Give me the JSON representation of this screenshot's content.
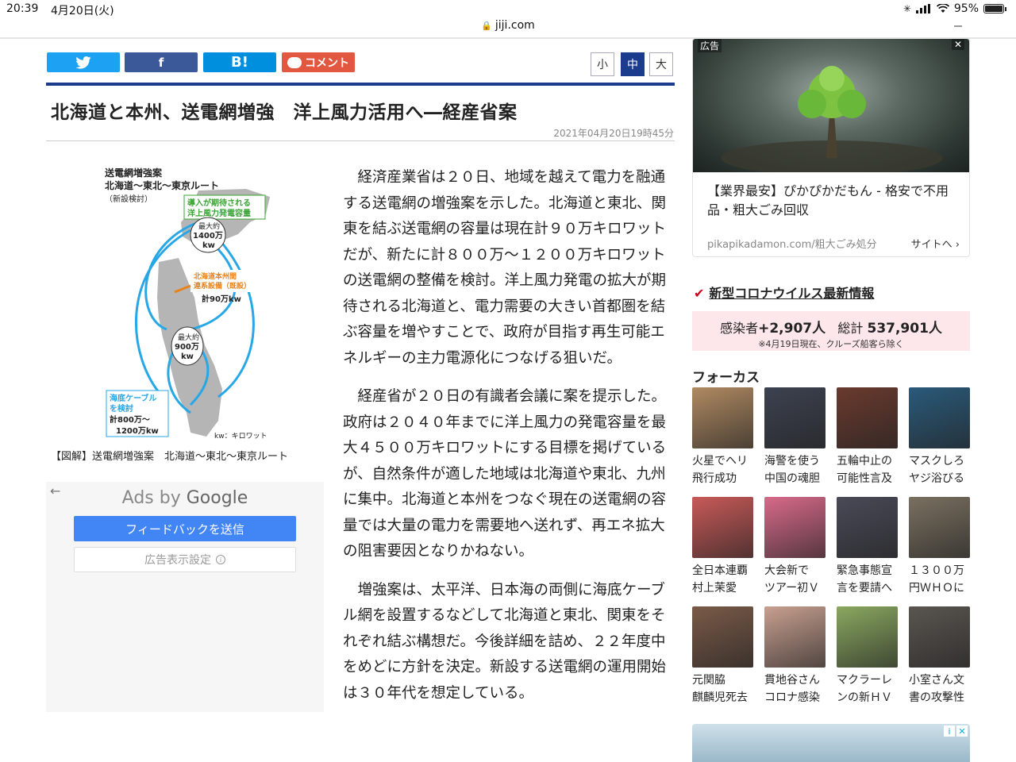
{
  "status": {
    "time": "20:39",
    "date": "4月20日(火)",
    "battery": "95%"
  },
  "browser": {
    "url": "jiji.com"
  },
  "share": {
    "twitter": "twitter",
    "facebook": "f",
    "hatena": "B!",
    "comment": "コメント"
  },
  "font_size": {
    "small": "小",
    "medium": "中",
    "large": "大"
  },
  "article": {
    "title": "北海道と本州、送電網増強　洋上風力活用へ―経産省案",
    "date": "2021年04月20日19時45分",
    "figure": {
      "heading": [
        "送電網増強案",
        "北海道～東北～東京ルート"
      ],
      "sub": "（新設検討）",
      "label_green": [
        "導入が期待される",
        "洋上風力発電容量"
      ],
      "max1": [
        "最大約",
        "1400万",
        "kw"
      ],
      "orange": [
        "北海道本州間",
        "連系設備（既設）"
      ],
      "orange_total": "計90万kw",
      "max2": [
        "最大約",
        "900万",
        "kw"
      ],
      "cable": [
        "海底ケーブル",
        "を検討",
        "計800万～",
        "1200万kw"
      ],
      "unit": "kw：キロワット"
    },
    "caption": "【図解】送電網増強案　北海道～東北～東京ルート",
    "paragraphs": [
      "経済産業省は２０日、地域を越えて電力を融通する送電網の増強案を示した。北海道と東北、関東を結ぶ送電網の容量は現在計９０万キロワットだが、新たに計８００万～１２００万キロワットの送電網の整備を検討。洋上風力発電の拡大が期待される北海道と、電力需要の大きい首都圏を結ぶ容量を増やすことで、政府が目指す再生可能エネルギーの主力電源化につなげる狙いだ。",
      "経産省が２０日の有識者会議に案を提示した。政府は２０４０年までに洋上風力の発電容量を最大４５００万キロワットにする目標を掲げているが、自然条件が適した地域は北海道や東北、九州に集中。北海道と本州をつなぐ現在の送電網の容量では大量の電力を需要地へ送れず、再エネ拡大の阻害要因となりかねない。",
      "増強案は、太平洋、日本海の両側に海底ケーブル網を設置するなどして北海道と東北、関東をそれぞれ結ぶ構想だ。今後詳細を詰め、２２年度中をめどに方針を決定。新設する送電網の運用開始は３０年代を想定している。"
    ]
  },
  "google_ad": {
    "back": "←",
    "ads_by": "Ads by",
    "google": "Google",
    "feedback": "フィードバックを送信",
    "settings": "広告表示設定"
  },
  "side_ad": {
    "label": "広告",
    "text": "【業界最安】ぴかぴかだもん - 格安で不用品・粗大ごみ回収",
    "domain": "pikapikadamon.com/粗大ごみ処分",
    "site": "サイトへ"
  },
  "corona": {
    "heading": "新型コロナウイルス最新情報",
    "infected_label": "感染者",
    "infected": "+2,907人",
    "total_label": "総計",
    "total": "537,901人",
    "note": "※4月19日現在、クルーズ船客ら除く"
  },
  "focus": {
    "heading": "フォーカス",
    "items": [
      {
        "l1": "火星でヘリ",
        "l2": "飛行成功",
        "color": "#b08a62"
      },
      {
        "l1": "海警を使う",
        "l2": "中国の魂胆",
        "color": "#3d4250"
      },
      {
        "l1": "五輪中止の",
        "l2": "可能性言及",
        "color": "#6a3a2e"
      },
      {
        "l1": "マスクしろ",
        "l2": "ヤジ浴びる",
        "color": "#2a5a7a"
      },
      {
        "l1": "全日本連覇",
        "l2": "村上茉愛",
        "color": "#c85a58"
      },
      {
        "l1": "大会新で",
        "l2": "ツアー初Ｖ",
        "color": "#d86a8a"
      },
      {
        "l1": "緊急事態宣",
        "l2": "言を要請へ",
        "color": "#4a4a58"
      },
      {
        "l1": "１３００万",
        "l2": "円ＷＨＯに",
        "color": "#7a7060"
      },
      {
        "l1": "元関脇",
        "l2": "麒麟児死去",
        "color": "#7a5a48"
      },
      {
        "l1": "貫地谷さん",
        "l2": "コロナ感染",
        "color": "#c8a090"
      },
      {
        "l1": "マクラーレ",
        "l2": "ンの新ＨＶ",
        "color": "#8aa860"
      },
      {
        "l1": "小室さん文",
        "l2": "書の攻撃性",
        "color": "#5a5550"
      }
    ]
  }
}
